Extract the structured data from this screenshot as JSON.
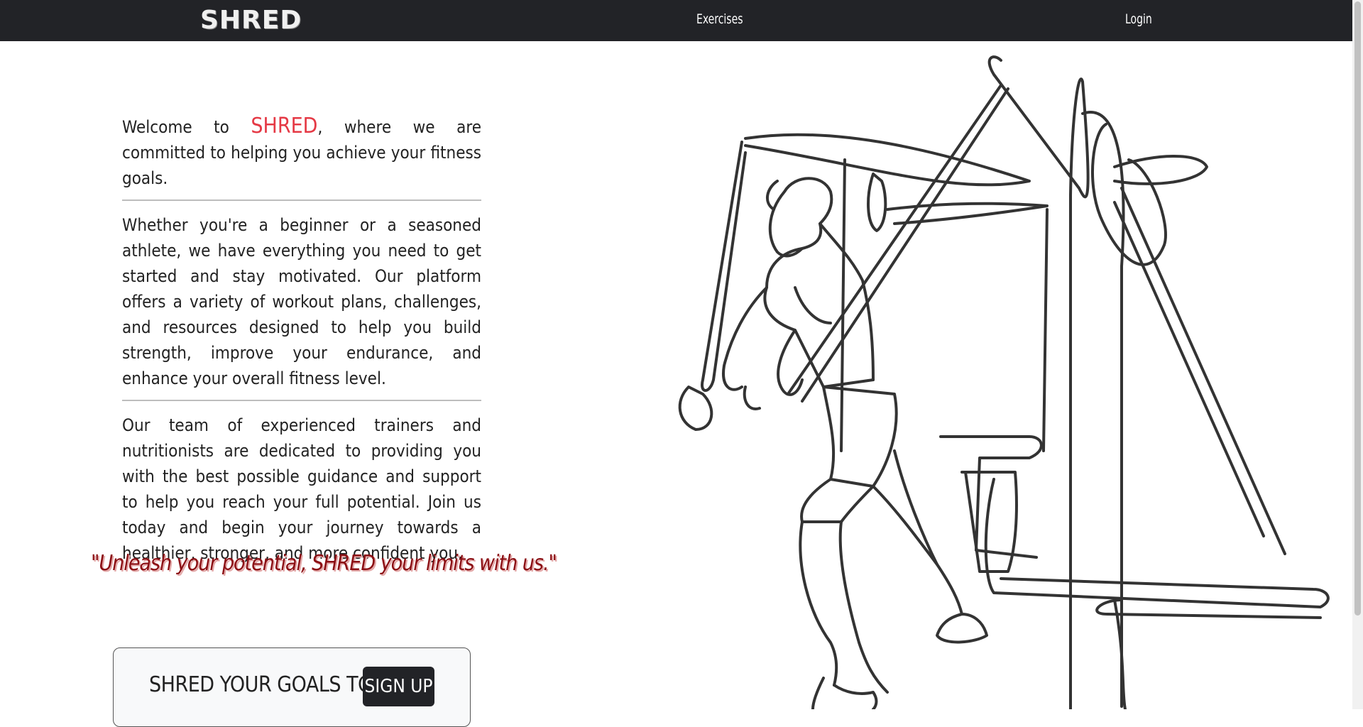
{
  "navbar": {
    "brand": "SHRED",
    "links": [
      {
        "label": "Exercises"
      },
      {
        "label": "Login"
      }
    ]
  },
  "intro": {
    "welcome_prefix": "Welcome to",
    "brand_word": "SHRED",
    "welcome_suffix": ", where we are committed to helping you achieve your fitness goals.",
    "paragraph2": "Whether you're a beginner or a seasoned athlete, we have everything you need to get started and stay motivated. Our platform offers a variety of workout plans, challenges, and resources designed to help you build strength, improve your endurance, and enhance your overall fitness level.",
    "paragraph3": "Our team of experienced trainers and nutritionists are dedicated to providing you with the best possible guidance and support to help you reach your full potential. Join us today and begin your journey towards a healthier, stronger, and more confident you."
  },
  "quote": "\"Unleash your potential, SHRED your limits with us.\"",
  "signup": {
    "text": "SHRED YOUR GOALS TODAY",
    "button_label": "SIGN UP"
  },
  "colors": {
    "navbar_bg": "#222327",
    "accent_red": "#e53945",
    "quote_red": "#8b0f14"
  },
  "illustration": {
    "icon": "line-art-gym-workout-illustration"
  }
}
